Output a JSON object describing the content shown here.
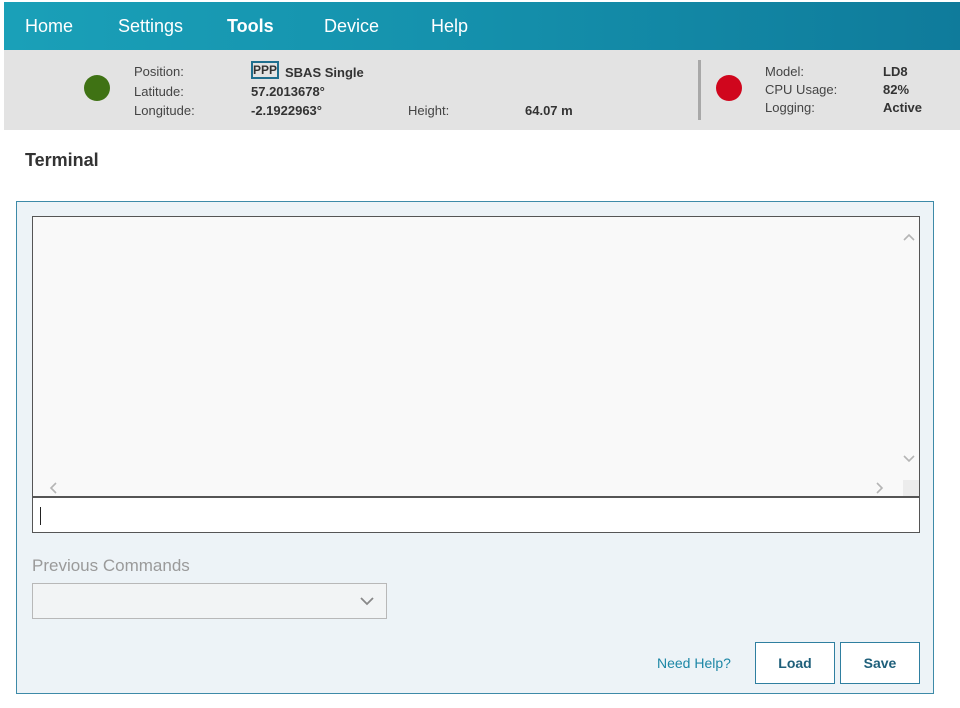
{
  "nav": {
    "items": [
      {
        "label": "Home",
        "active": false
      },
      {
        "label": "Settings",
        "active": false
      },
      {
        "label": "Tools",
        "active": true
      },
      {
        "label": "Device",
        "active": false
      },
      {
        "label": "Help",
        "active": false
      }
    ],
    "gradient_colors": [
      "#1aa0b8",
      "#0f7b9b"
    ]
  },
  "status": {
    "position_indicator_color": "#3f7214",
    "position_label": "Position:",
    "position_badge": "PPP",
    "position_mode": "SBAS Single",
    "latitude_label": "Latitude:",
    "latitude_value": "57.2013678°",
    "longitude_label": "Longitude:",
    "longitude_value": "-2.1922963°",
    "height_label": "Height:",
    "height_value": "64.07 m",
    "device_indicator_color": "#d0061d",
    "model_label": "Model:",
    "model_value": "LD8",
    "cpu_label": "CPU Usage:",
    "cpu_value": "82%",
    "logging_label": "Logging:",
    "logging_value": "Active"
  },
  "terminal": {
    "title": "Terminal",
    "output_text": "",
    "input_value": "",
    "previous_commands_label": "Previous Commands",
    "previous_commands_selected": "",
    "help_link": "Need Help?",
    "load_label": "Load",
    "save_label": "Save",
    "accent_color": "#1d87a6"
  },
  "icons": {
    "scroll_up": "chevron-up-icon",
    "scroll_down": "chevron-down-icon",
    "scroll_left": "chevron-left-icon",
    "scroll_right": "chevron-right-icon",
    "select_arrow": "chevron-down-icon"
  }
}
